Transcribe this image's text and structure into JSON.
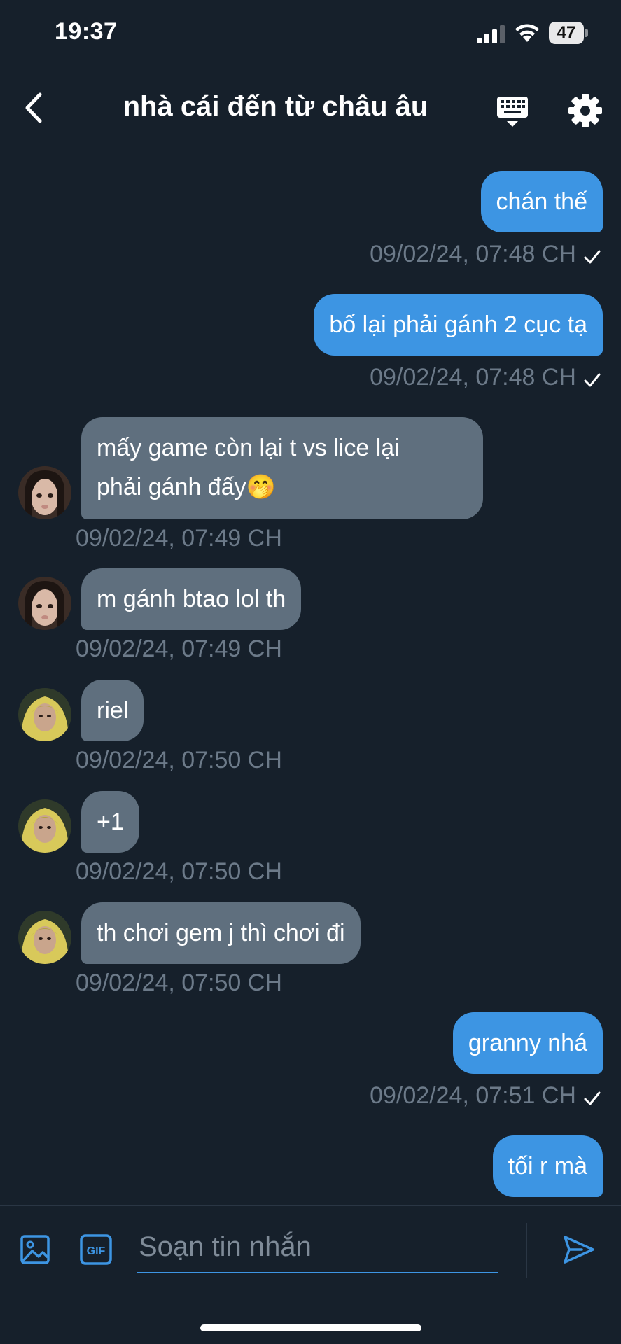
{
  "status_bar": {
    "time": "19:37",
    "battery": "47"
  },
  "header": {
    "title": "nhà cái đến từ châu âu"
  },
  "messages": [
    {
      "direction": "out",
      "text": "chán thế",
      "timestamp": "09/02/24, 07:48 CH",
      "read": true
    },
    {
      "direction": "out",
      "text": "bố lại phải gánh 2 cục tạ",
      "timestamp": "09/02/24, 07:48 CH",
      "read": true
    },
    {
      "direction": "in",
      "avatar": "avatar-girl",
      "text_line1": "mấy game còn lại t vs lice lại",
      "text_line2": "phải gánh đấy🤭",
      "timestamp": "09/02/24, 07:49 CH"
    },
    {
      "direction": "in",
      "avatar": "avatar-girl",
      "text": "m gánh btao lol th",
      "timestamp": "09/02/24, 07:49 CH"
    },
    {
      "direction": "in",
      "avatar": "avatar-yellow-hood",
      "text": "riel",
      "timestamp": "09/02/24, 07:50 CH"
    },
    {
      "direction": "in",
      "avatar": "avatar-yellow-hood",
      "text": "+1",
      "timestamp": "09/02/24, 07:50 CH"
    },
    {
      "direction": "in",
      "avatar": "avatar-yellow-hood",
      "text": "th chơi gem j thì chơi đi",
      "timestamp": "09/02/24, 07:50 CH"
    },
    {
      "direction": "out",
      "text": "granny nhá",
      "timestamp": "09/02/24, 07:51 CH",
      "read": true
    },
    {
      "direction": "out",
      "text": "tối r mà"
    }
  ],
  "composer": {
    "placeholder": "Soạn tin nhắn",
    "gif_label": "GIF"
  },
  "colors": {
    "background": "#16202b",
    "outgoing_bubble": "#3d95e3",
    "incoming_bubble": "#5f6f7e",
    "timestamp": "#6c7a89",
    "accent": "#3d95e3"
  },
  "icons": {
    "back": "chevron-left-icon",
    "keyboard": "keyboard-icon",
    "settings": "gear-icon",
    "image": "image-icon",
    "gif": "gif-icon",
    "send": "send-icon",
    "read": "checkmark-icon"
  }
}
